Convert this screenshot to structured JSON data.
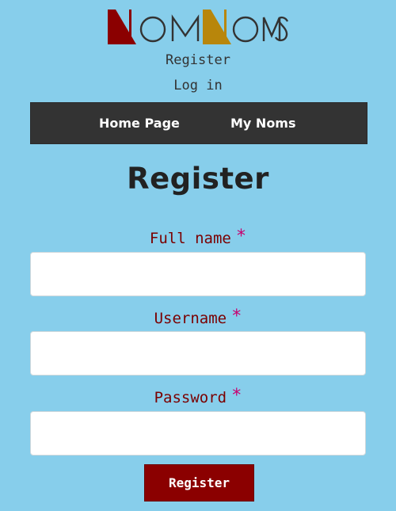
{
  "brand": {
    "logo_text": "NomNoms",
    "colors": {
      "first_n": "#8b0000",
      "second_n": "#b8860b",
      "letters": "#333333"
    }
  },
  "top_links": {
    "register": "Register",
    "login": "Log in"
  },
  "nav": {
    "items": [
      {
        "label": "Home Page"
      },
      {
        "label": "My Noms"
      }
    ]
  },
  "page": {
    "title": "Register"
  },
  "form": {
    "fields": [
      {
        "label": "Full name",
        "required_mark": "*",
        "value": "",
        "placeholder": ""
      },
      {
        "label": "Username",
        "required_mark": "*",
        "value": "",
        "placeholder": ""
      },
      {
        "label": "Password",
        "required_mark": "*",
        "value": "",
        "placeholder": ""
      }
    ],
    "submit_label": "Register"
  },
  "theme": {
    "background": "#87ceeb",
    "navbar": "#333333",
    "label_color": "#7a0000",
    "required_color": "#c8006e",
    "button_color": "#8b0000"
  }
}
